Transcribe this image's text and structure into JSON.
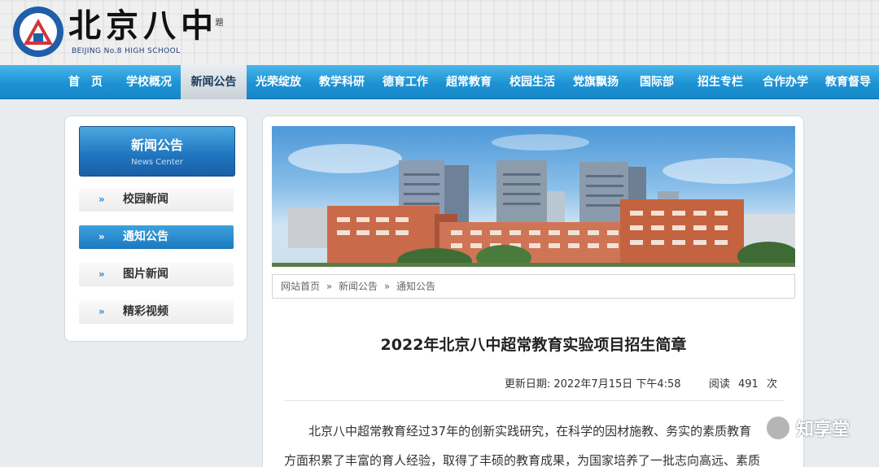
{
  "header": {
    "logo_title": "北京八中",
    "logo_sign": "題",
    "logo_subtitle": "BEIJING No.8 HIGH SCHOOL"
  },
  "nav": {
    "items": [
      "首　页",
      "学校概况",
      "新闻公告",
      "光荣绽放",
      "教学科研",
      "德育工作",
      "超常教育",
      "校园生活",
      "党旗飘扬",
      "国际部",
      "招生专栏",
      "合作办学",
      "教育督导"
    ],
    "active": "新闻公告"
  },
  "sidebar": {
    "header_title": "新闻公告",
    "header_subtitle": "News Center",
    "items": [
      "校园新闻",
      "通知公告",
      "图片新闻",
      "精彩视频"
    ],
    "arrow": "»",
    "active": "通知公告"
  },
  "breadcrumb": {
    "items": [
      "网站首页",
      "新闻公告",
      "通知公告"
    ],
    "separator": "»"
  },
  "article": {
    "title": "2022年北京八中超常教育实验项目招生简章",
    "updated_label": "更新日期: 2022年7月15日 下午4:58",
    "views_label": "阅读",
    "views": "491",
    "views_unit": "次",
    "para1": "北京八中超常教育经过37年的创新实践研究，在科学的因材施教、务实的素质教育",
    "para2": "方面积累了丰富的育人经验，取得了丰硕的教育成果，为国家培养了一批志向高远、素质"
  },
  "watermark": {
    "text": "知享堂"
  },
  "colors": {
    "nav_blue": "#1d93d4",
    "sidebar_active": "#1b78c0",
    "background": "#e8ecef"
  }
}
